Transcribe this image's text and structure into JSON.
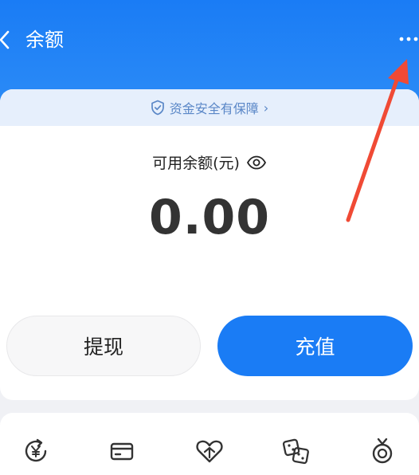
{
  "header": {
    "title": "余额",
    "back_icon": "chevron-left-icon",
    "more_icon": "more-dots-icon"
  },
  "safety": {
    "text": "资金安全有保障",
    "arrow": "›"
  },
  "balance": {
    "label": "可用余额(元)",
    "value": "0.00"
  },
  "actions": {
    "withdraw_label": "提现",
    "recharge_label": "充值"
  },
  "bottom_icons": [
    "yuan-refresh-icon",
    "card-icon",
    "heart-icon",
    "dice-icon",
    "medal-icon"
  ],
  "colors": {
    "brand": "#1a7cf5",
    "annotation": "#f04a35",
    "safety_text": "#5a87c7"
  }
}
